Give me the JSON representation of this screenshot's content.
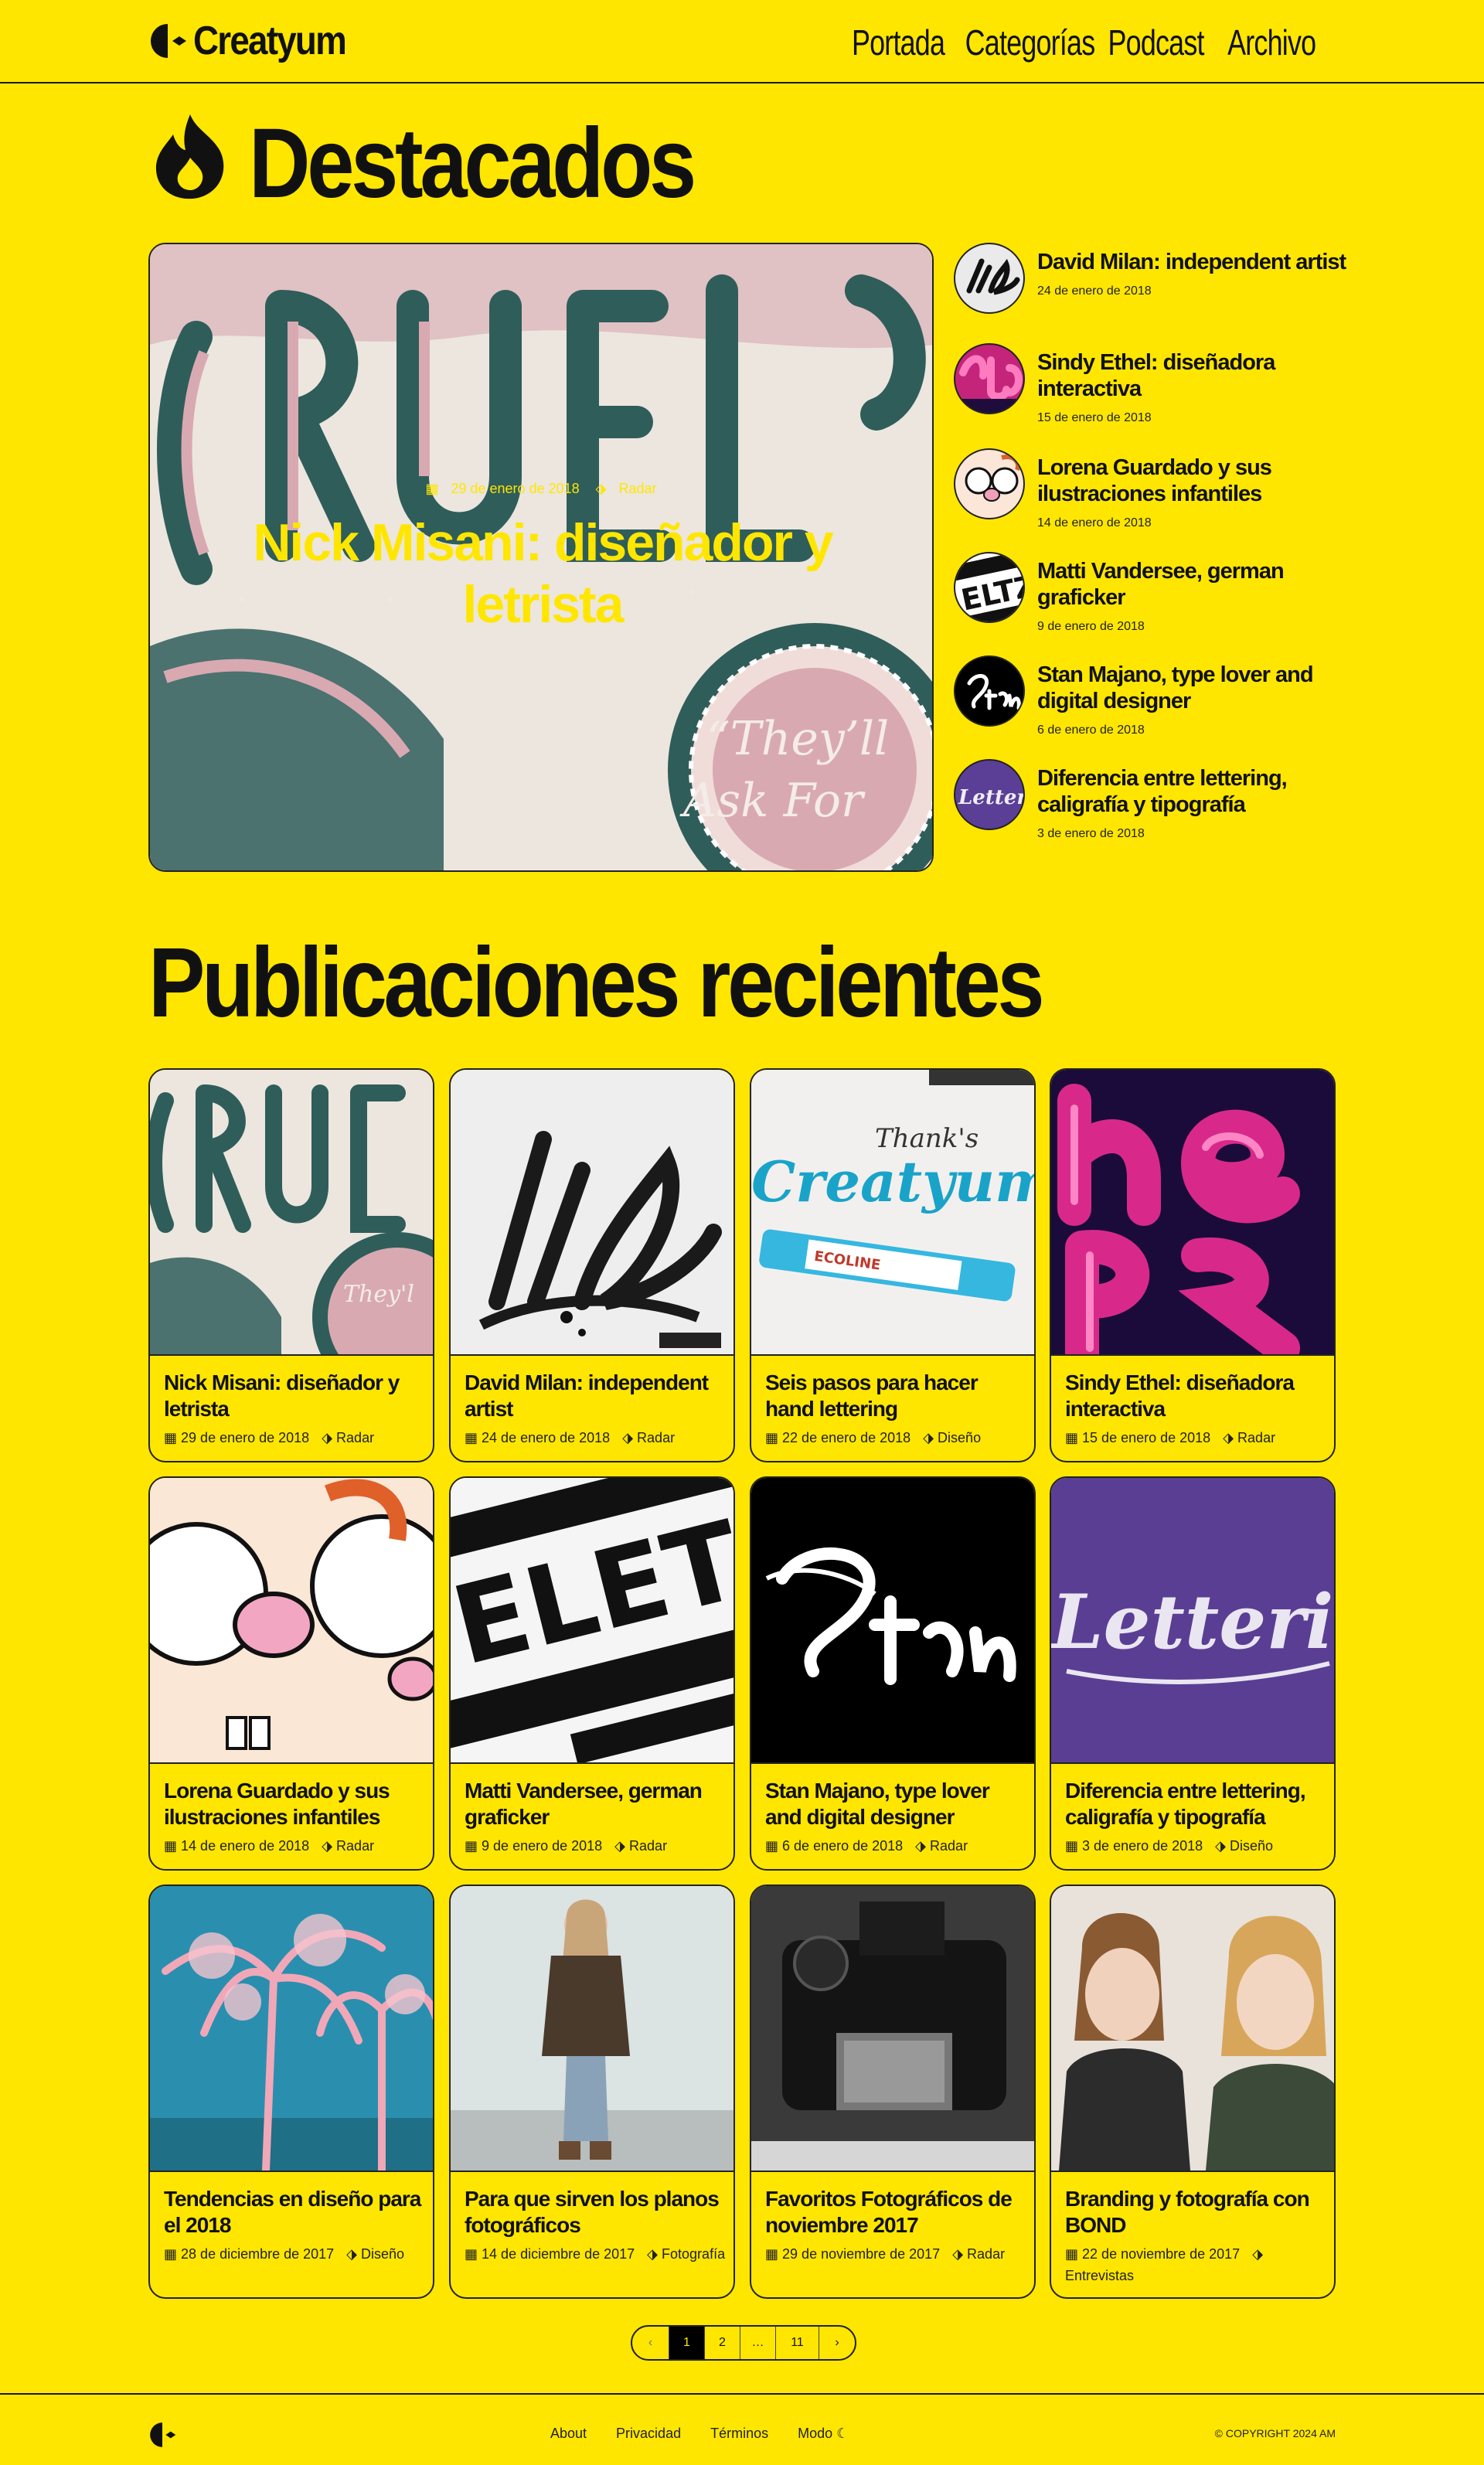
{
  "header": {
    "logo_text": "Creatyum",
    "nav": [
      "Portada",
      "Categorías",
      "Podcast",
      "Archivo"
    ]
  },
  "featured": {
    "title": "Destacados",
    "hero": {
      "date": "29 de enero de 2018",
      "category": "Radar",
      "title": "Nick Misani: diseñador y letrista"
    },
    "list": [
      {
        "title": "David Milan: independent artist",
        "date": "24 de enero de 2018"
      },
      {
        "title": "Sindy Ethel: diseñadora interactiva",
        "date": "15 de enero de 2018"
      },
      {
        "title": "Lorena Guardado y sus ilustraciones infantiles",
        "date": "14 de enero de 2018"
      },
      {
        "title": "Matti Vandersee, german graficker",
        "date": "9 de enero de 2018"
      },
      {
        "title": "Stan Majano, type lover and digital designer",
        "date": "6 de enero de 2018"
      },
      {
        "title": "Diferencia entre lettering, caligrafía y tipografía",
        "date": "3 de enero de 2018"
      }
    ]
  },
  "recent": {
    "title": "Publicaciones recientes",
    "posts": [
      {
        "title": "Nick Misani: diseñador y letrista",
        "date": "29 de enero de 2018",
        "category": "Radar"
      },
      {
        "title": "David Milan: independent artist",
        "date": "24 de enero de 2018",
        "category": "Radar"
      },
      {
        "title": "Seis pasos para hacer hand lettering",
        "date": "22 de enero de 2018",
        "category": "Diseño"
      },
      {
        "title": "Sindy Ethel: diseñadora interactiva",
        "date": "15 de enero de 2018",
        "category": "Radar"
      },
      {
        "title": "Lorena Guardado y sus ilustraciones infantiles",
        "date": "14 de enero de 2018",
        "category": "Radar"
      },
      {
        "title": "Matti Vandersee, german graficker",
        "date": "9 de enero de 2018",
        "category": "Radar"
      },
      {
        "title": "Stan Majano, type lover and digital designer",
        "date": "6 de enero de 2018",
        "category": "Radar"
      },
      {
        "title": "Diferencia entre lettering, caligrafía y tipografía",
        "date": "3 de enero de 2018",
        "category": "Diseño"
      },
      {
        "title": "Tendencias en diseño para el 2018",
        "date": "28 de diciembre de 2017",
        "category": "Diseño"
      },
      {
        "title": "Para que sirven los planos fotográficos",
        "date": "14 de diciembre de 2017",
        "category": "Fotografía"
      },
      {
        "title": "Favoritos Fotográficos de noviembre 2017",
        "date": "29 de noviembre de 2017",
        "category": "Radar"
      },
      {
        "title": "Branding y fotografía con BOND",
        "date": "22 de noviembre de 2017",
        "category": "Entrevistas"
      }
    ]
  },
  "pagination": {
    "prev": "‹",
    "pages": [
      "1",
      "2",
      "…",
      "11"
    ],
    "next": "›"
  },
  "footer": {
    "links": [
      "About",
      "Privacidad",
      "Términos",
      "Modo"
    ],
    "copyright": "© COPYRIGHT 2024 AM"
  },
  "colors": {
    "background": "#FFE600",
    "text": "#111111",
    "border": "#222222"
  }
}
